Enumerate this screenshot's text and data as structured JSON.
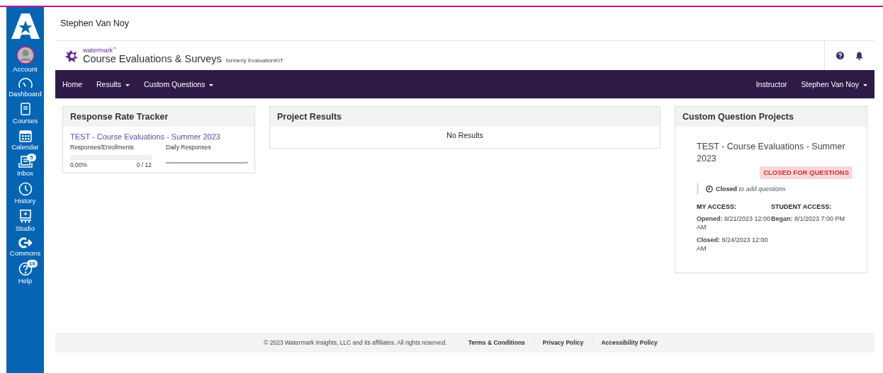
{
  "sidebar": {
    "items": [
      {
        "label": "Account",
        "kind": "account",
        "selected": false
      },
      {
        "label": "Dashboard",
        "kind": "dashboard",
        "selected": false
      },
      {
        "label": "Courses",
        "kind": "courses",
        "selected": false
      },
      {
        "label": "Calendar",
        "kind": "calendar",
        "selected": false
      },
      {
        "label": "Inbox",
        "kind": "inbox",
        "badge": "5",
        "selected": false
      },
      {
        "label": "History",
        "kind": "history",
        "selected": false
      },
      {
        "label": "Studio",
        "kind": "studio",
        "selected": false
      },
      {
        "label": "Commons",
        "kind": "commons",
        "selected": false
      },
      {
        "label": "Help",
        "kind": "help",
        "badge": "10",
        "selected": false
      }
    ]
  },
  "page_title": "Stephen Van Noy",
  "brand": {
    "small": "watermark",
    "trademark": "™",
    "product": "Course Evaluations & Surveys",
    "note": "formerly EvaluationKIT"
  },
  "nav": {
    "left": [
      {
        "label": "Home",
        "dropdown": false
      },
      {
        "label": "Results",
        "dropdown": true
      },
      {
        "label": "Custom Questions",
        "dropdown": true
      }
    ],
    "right": [
      {
        "label": "Instructor",
        "dropdown": false
      },
      {
        "label": "Stephen Van Noy",
        "dropdown": true
      }
    ]
  },
  "tracker": {
    "title": "Response Rate Tracker",
    "project": "TEST - Course Evaluations - Summer 2023",
    "col_1": "Responses/Enrollments",
    "col_2": "Daily Responses",
    "level": 0,
    "percent": "0.00%",
    "count": "0 / 12"
  },
  "results": {
    "title": "Project Results",
    "empty": "No Results"
  },
  "custom": {
    "title": "Custom Question Projects",
    "project": "TEST - Course Evaluations - Summer 2023",
    "status": "CLOSED FOR QUESTIONS",
    "state_label": "Closed",
    "state_note": "to add questions",
    "columns": [
      {
        "heading": "MY ACCESS:",
        "entries": [
          {
            "label": "Opened:",
            "value": "8/21/2023 12:00 AM"
          },
          {
            "label": "Closed:",
            "value": "8/24/2023 12:00 AM"
          }
        ]
      },
      {
        "heading": "STUDENT ACCESS:",
        "entries": [
          {
            "label": "Began:",
            "value": "8/1/2023 7:00 PM"
          }
        ]
      }
    ]
  },
  "footer": {
    "copyright": "© 2023 Watermark Insights, LLC and its affiliates. All rights reserved.",
    "links": [
      "Terms & Conditions",
      "Privacy Policy",
      "Accessibility Policy"
    ]
  }
}
